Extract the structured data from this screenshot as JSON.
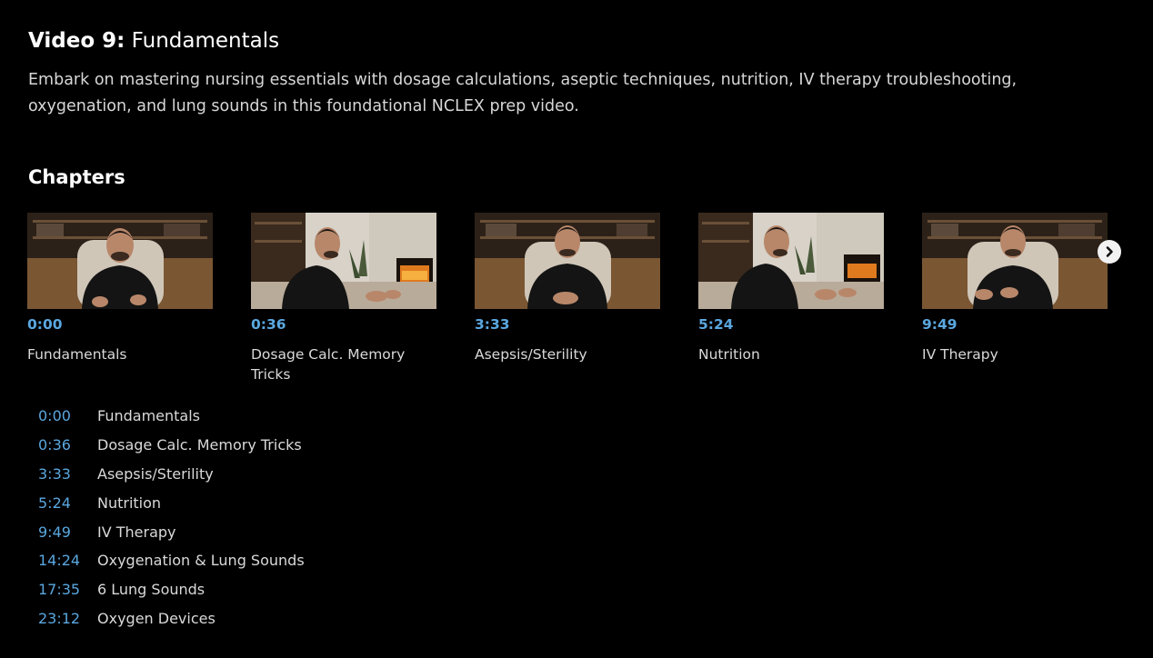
{
  "video": {
    "title_prefix": "Video 9:",
    "title_name": "Fundamentals",
    "description": "Embark on mastering nursing essentials with dosage calculations, aseptic techniques, nutrition, IV therapy troubleshooting, oxygenation, and lung sounds in this foundational NCLEX prep video."
  },
  "chapters_heading": "Chapters",
  "carousel": {
    "cards": [
      {
        "time": "0:00",
        "title": "Fundamentals",
        "setting": "bookshelf"
      },
      {
        "time": "0:36",
        "title": "Dosage Calc. Memory Tricks",
        "setting": "fireplace"
      },
      {
        "time": "3:33",
        "title": "Asepsis/Sterility",
        "setting": "bookshelf"
      },
      {
        "time": "5:24",
        "title": "Nutrition",
        "setting": "fireplace"
      },
      {
        "time": "9:49",
        "title": "IV Therapy",
        "setting": "bookshelf"
      }
    ],
    "next_icon": "chevron-right-icon"
  },
  "chapter_list": [
    {
      "time": "0:00",
      "title": "Fundamentals"
    },
    {
      "time": "0:36",
      "title": "Dosage Calc. Memory Tricks"
    },
    {
      "time": "3:33",
      "title": "Asepsis/Sterility"
    },
    {
      "time": "5:24",
      "title": "Nutrition"
    },
    {
      "time": "9:49",
      "title": "IV Therapy"
    },
    {
      "time": "14:24",
      "title": "Oxygenation & Lung Sounds"
    },
    {
      "time": "17:35",
      "title": "6 Lung Sounds"
    },
    {
      "time": "23:12",
      "title": "Oxygen Devices"
    }
  ],
  "colors": {
    "background": "#000000",
    "timestamp": "#5aa7df",
    "text": "#d9d9d9"
  }
}
